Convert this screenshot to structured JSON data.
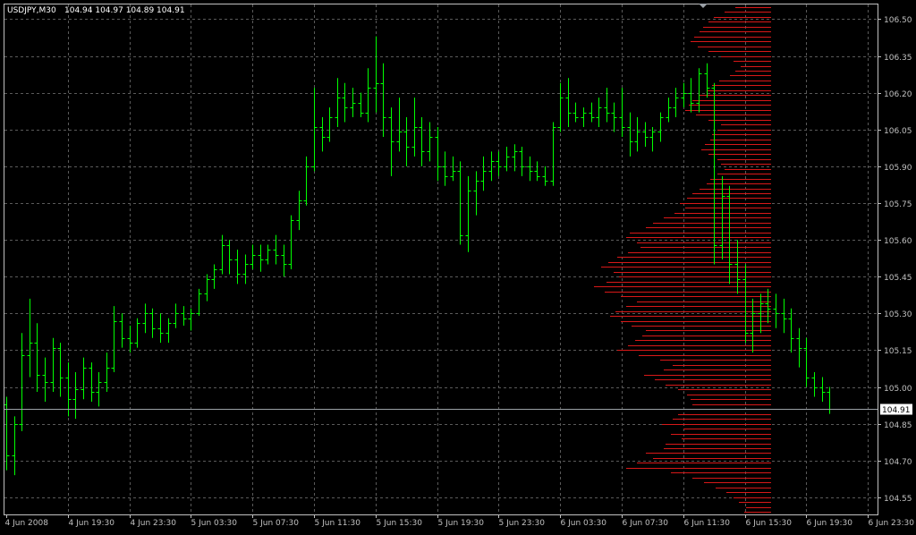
{
  "header": {
    "symbol": "USDJPY,M30",
    "quote": "104.94 104.97 104.89 104.91"
  },
  "colors": {
    "background": "#000000",
    "grid": "#5a5a5a",
    "axis": "#c0c0c0",
    "bar": "#00ff00",
    "profile": "#d81818",
    "last_line": "#9aa0a6",
    "label_bg": "#ffffff"
  },
  "chart_data": {
    "type": "ohlc-bar",
    "symbol": "USDJPY",
    "timeframe": "M30",
    "ylim": [
      104.48,
      106.56
    ],
    "y_ticks": [
      104.55,
      104.7,
      104.85,
      105.0,
      105.15,
      105.3,
      105.45,
      105.6,
      105.75,
      105.9,
      106.05,
      106.2,
      106.35,
      106.5
    ],
    "y_tick_labels": [
      "104.55",
      "104.70",
      "104.85",
      "105.00",
      "105.15",
      "105.30",
      "105.45",
      "105.60",
      "105.75",
      "105.90",
      "106.05",
      "106.20",
      "106.35",
      "106.50"
    ],
    "x_tick_labels": [
      "4 Jun 2008",
      "4 Jun 19:30",
      "4 Jun 23:30",
      "5 Jun 03:30",
      "5 Jun 07:30",
      "5 Jun 11:30",
      "5 Jun 15:30",
      "5 Jun 19:30",
      "5 Jun 23:30",
      "6 Jun 03:30",
      "6 Jun 07:30",
      "6 Jun 11:30",
      "6 Jun 15:30",
      "6 Jun 19:30",
      "6 Jun 23:30"
    ],
    "last_price": 104.91,
    "last_price_label": "104.91",
    "grid": true,
    "bars": [
      [
        104.93,
        104.96,
        104.66,
        104.72
      ],
      [
        104.72,
        104.88,
        104.64,
        104.85
      ],
      [
        104.85,
        105.22,
        104.82,
        105.13
      ],
      [
        105.13,
        105.36,
        105.04,
        105.18
      ],
      [
        105.18,
        105.26,
        104.98,
        105.05
      ],
      [
        105.05,
        105.12,
        104.94,
        105.02
      ],
      [
        105.02,
        105.2,
        104.98,
        105.16
      ],
      [
        105.16,
        105.18,
        104.96,
        105.04
      ],
      [
        105.04,
        105.1,
        104.88,
        104.95
      ],
      [
        104.95,
        105.06,
        104.87,
        104.99
      ],
      [
        104.99,
        105.12,
        104.95,
        105.08
      ],
      [
        105.08,
        105.1,
        104.94,
        104.98
      ],
      [
        104.98,
        105.06,
        104.92,
        105.02
      ],
      [
        105.02,
        105.14,
        104.98,
        105.08
      ],
      [
        105.08,
        105.33,
        105.06,
        105.27
      ],
      [
        105.27,
        105.3,
        105.16,
        105.2
      ],
      [
        105.2,
        105.25,
        105.14,
        105.18
      ],
      [
        105.18,
        105.28,
        105.16,
        105.26
      ],
      [
        105.26,
        105.34,
        105.22,
        105.3
      ],
      [
        105.3,
        105.32,
        105.2,
        105.24
      ],
      [
        105.24,
        105.3,
        105.18,
        105.22
      ],
      [
        105.22,
        105.28,
        105.18,
        105.26
      ],
      [
        105.26,
        105.34,
        105.24,
        105.3
      ],
      [
        105.3,
        105.33,
        105.25,
        105.28
      ],
      [
        105.28,
        105.32,
        105.23,
        105.3
      ],
      [
        105.3,
        105.4,
        105.29,
        105.38
      ],
      [
        105.38,
        105.46,
        105.35,
        105.44
      ],
      [
        105.44,
        105.5,
        105.4,
        105.48
      ],
      [
        105.48,
        105.62,
        105.46,
        105.58
      ],
      [
        105.58,
        105.6,
        105.46,
        105.52
      ],
      [
        105.52,
        105.56,
        105.42,
        105.46
      ],
      [
        105.46,
        105.54,
        105.42,
        105.5
      ],
      [
        105.5,
        105.58,
        105.48,
        105.54
      ],
      [
        105.54,
        105.58,
        105.47,
        105.52
      ],
      [
        105.52,
        105.58,
        105.5,
        105.56
      ],
      [
        105.56,
        105.62,
        105.5,
        105.54
      ],
      [
        105.54,
        105.58,
        105.45,
        105.5
      ],
      [
        105.5,
        105.7,
        105.48,
        105.68
      ],
      [
        105.68,
        105.8,
        105.64,
        105.76
      ],
      [
        105.76,
        105.94,
        105.74,
        105.9
      ],
      [
        105.9,
        106.22,
        105.88,
        106.06
      ],
      [
        106.06,
        106.1,
        105.96,
        106.02
      ],
      [
        106.02,
        106.14,
        106.0,
        106.1
      ],
      [
        106.1,
        106.26,
        106.06,
        106.18
      ],
      [
        106.18,
        106.24,
        106.08,
        106.14
      ],
      [
        106.14,
        106.22,
        106.1,
        106.16
      ],
      [
        106.16,
        106.2,
        106.1,
        106.12
      ],
      [
        106.12,
        106.3,
        106.08,
        106.22
      ],
      [
        106.22,
        106.43,
        106.12,
        106.24
      ],
      [
        106.24,
        106.32,
        106.02,
        106.1
      ],
      [
        106.1,
        106.14,
        105.86,
        106.0
      ],
      [
        106.0,
        106.18,
        105.96,
        106.04
      ],
      [
        106.04,
        106.1,
        105.9,
        105.98
      ],
      [
        105.98,
        106.18,
        105.94,
        106.06
      ],
      [
        106.06,
        106.1,
        105.9,
        105.96
      ],
      [
        105.96,
        106.08,
        105.92,
        106.02
      ],
      [
        106.02,
        106.06,
        105.84,
        105.9
      ],
      [
        105.9,
        105.96,
        105.82,
        105.86
      ],
      [
        105.86,
        105.94,
        105.84,
        105.88
      ],
      [
        105.88,
        105.92,
        105.58,
        105.62
      ],
      [
        105.62,
        105.86,
        105.55,
        105.8
      ],
      [
        105.8,
        105.88,
        105.7,
        105.84
      ],
      [
        105.84,
        105.94,
        105.8,
        105.88
      ],
      [
        105.88,
        105.96,
        105.84,
        105.92
      ],
      [
        105.92,
        105.96,
        105.86,
        105.9
      ],
      [
        105.9,
        105.98,
        105.88,
        105.94
      ],
      [
        105.94,
        105.99,
        105.88,
        105.96
      ],
      [
        105.96,
        105.98,
        105.86,
        105.9
      ],
      [
        105.9,
        105.94,
        105.84,
        105.88
      ],
      [
        105.88,
        105.92,
        105.84,
        105.86
      ],
      [
        105.86,
        105.9,
        105.82,
        105.84
      ],
      [
        105.84,
        106.08,
        105.82,
        106.06
      ],
      [
        106.06,
        106.24,
        106.04,
        106.18
      ],
      [
        106.18,
        106.26,
        106.06,
        106.12
      ],
      [
        106.12,
        106.16,
        106.08,
        106.1
      ],
      [
        106.1,
        106.14,
        106.06,
        106.12
      ],
      [
        106.12,
        106.16,
        106.08,
        106.1
      ],
      [
        106.1,
        106.18,
        106.06,
        106.14
      ],
      [
        106.14,
        106.22,
        106.08,
        106.12
      ],
      [
        106.12,
        106.16,
        106.04,
        106.1
      ],
      [
        106.1,
        106.22,
        106.02,
        106.06
      ],
      [
        106.06,
        106.12,
        105.94,
        106.0
      ],
      [
        106.0,
        106.1,
        105.96,
        106.04
      ],
      [
        106.04,
        106.08,
        105.98,
        106.02
      ],
      [
        106.02,
        106.06,
        105.96,
        106.04
      ],
      [
        106.04,
        106.12,
        106.0,
        106.1
      ],
      [
        106.1,
        106.18,
        106.08,
        106.14
      ],
      [
        106.14,
        106.22,
        106.1,
        106.18
      ],
      [
        106.18,
        106.24,
        106.14,
        106.2
      ],
      [
        106.2,
        106.26,
        106.12,
        106.16
      ],
      [
        106.16,
        106.3,
        106.12,
        106.28
      ],
      [
        106.28,
        106.32,
        106.18,
        106.22
      ],
      [
        106.22,
        106.24,
        105.5,
        105.58
      ],
      [
        105.58,
        105.86,
        105.52,
        105.78
      ],
      [
        105.78,
        105.82,
        105.42,
        105.5
      ],
      [
        105.5,
        105.6,
        105.38,
        105.44
      ],
      [
        105.44,
        105.5,
        105.18,
        105.22
      ],
      [
        105.22,
        105.36,
        105.14,
        105.3
      ],
      [
        105.3,
        105.38,
        105.22,
        105.34
      ],
      [
        105.34,
        105.4,
        105.26,
        105.32
      ],
      [
        105.32,
        105.38,
        105.24,
        105.3
      ],
      [
        105.3,
        105.36,
        105.22,
        105.28
      ],
      [
        105.28,
        105.32,
        105.14,
        105.2
      ],
      [
        105.2,
        105.24,
        105.08,
        105.16
      ],
      [
        105.16,
        105.2,
        105.0,
        105.04
      ],
      [
        105.04,
        105.06,
        104.96,
        105.0
      ],
      [
        105.0,
        105.04,
        104.94,
        104.98
      ],
      [
        104.98,
        105.0,
        104.89,
        104.91
      ]
    ],
    "profile": {
      "color": "#d81818",
      "min_price": 104.48,
      "bin_size": 0.02,
      "volumes": [
        30,
        28,
        36,
        42,
        50,
        62,
        75,
        88,
        112,
        162,
        150,
        132,
        140,
        120,
        118,
        100,
        112,
        98,
        122,
        110,
        104,
        96,
        88,
        90,
        94,
        104,
        118,
        130,
        142,
        120,
        110,
        124,
        148,
        172,
        160,
        152,
        144,
        140,
        156,
        168,
        180,
        174,
        162,
        150,
        168,
        186,
        198,
        184,
        170,
        176,
        190,
        182,
        172,
        160,
        146,
        150,
        162,
        158,
        140,
        132,
        120,
        108,
        96,
        102,
        94,
        88,
        80,
        72,
        68,
        60,
        52,
        56,
        60,
        70,
        78,
        74,
        68,
        66,
        60,
        56,
        70,
        84,
        96,
        92,
        88,
        80,
        72,
        66,
        58,
        46,
        40,
        34,
        42,
        56,
        70,
        82,
        90,
        86,
        80,
        76,
        70,
        64,
        52,
        40
      ]
    }
  }
}
